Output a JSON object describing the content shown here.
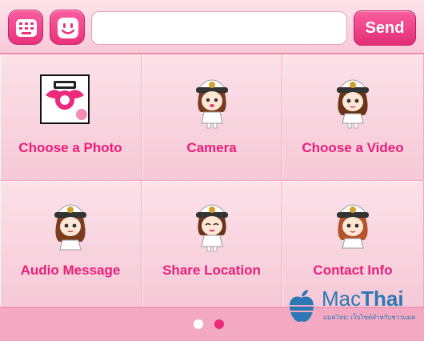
{
  "toolbar": {
    "keyboard_icon": "keyboard-icon",
    "emoticon_icon": "smiley-face-icon",
    "message_value": "",
    "send_label": "Send"
  },
  "menu": {
    "items": [
      {
        "label": "Choose a Photo",
        "icon": "photo-album-icon"
      },
      {
        "label": "Camera",
        "icon": "sailor-girl-camera-icon"
      },
      {
        "label": "Choose a Video",
        "icon": "sailor-girl-video-icon"
      },
      {
        "label": "Audio Message",
        "icon": "sailor-girl-audio-icon"
      },
      {
        "label": "Share Location",
        "icon": "sailor-girl-location-icon"
      },
      {
        "label": "Contact Info",
        "icon": "sailor-girl-contact-icon"
      }
    ]
  },
  "pager": {
    "total": 2,
    "current": 2
  },
  "watermark": {
    "brand_prefix": "Mac",
    "brand_suffix": "Thai",
    "tagline": "แมคไทย: เว็บไซต์สำหรับชาวแมค"
  },
  "colors": {
    "accent": "#ec1d78",
    "background": "#f7c6d6",
    "button": "#e8337d"
  }
}
